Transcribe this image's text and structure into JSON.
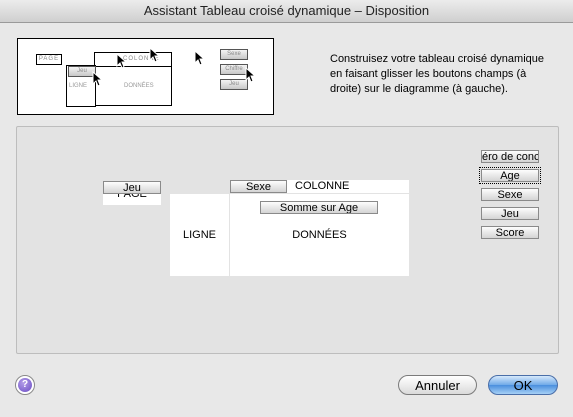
{
  "window": {
    "title": "Assistant Tableau croisé dynamique – Disposition"
  },
  "preview": {
    "page_tag": "PAGE",
    "column_tag": "COLONNE",
    "row_tag": "LIGNE",
    "data_tag": "DONNÉES",
    "field_buttons": [
      "Chiffre",
      "Jeu",
      "Sexe"
    ]
  },
  "instructions": "Construisez votre tableau croisé dynamique en faisant glisser les boutons champs (à droite) sur le diagramme (à gauche).",
  "layout": {
    "page_label": "PAGE",
    "page_field": "Jeu",
    "column_label": "COLONNE",
    "column_field": "Sexe",
    "row_label": "LIGNE",
    "data_label": "DONNÉES",
    "data_field": "Somme sur Age"
  },
  "fields": [
    "Numéro de concours",
    "Age",
    "Sexe",
    "Jeu",
    "Score"
  ],
  "fields_display": [
    "éro de conco",
    "Age",
    "Sexe",
    "Jeu",
    "Score"
  ],
  "buttons": {
    "help": "?",
    "cancel": "Annuler",
    "ok": "OK"
  },
  "colors": {
    "default_button": "#4a8fde",
    "help_icon": "#6a4cc4"
  }
}
